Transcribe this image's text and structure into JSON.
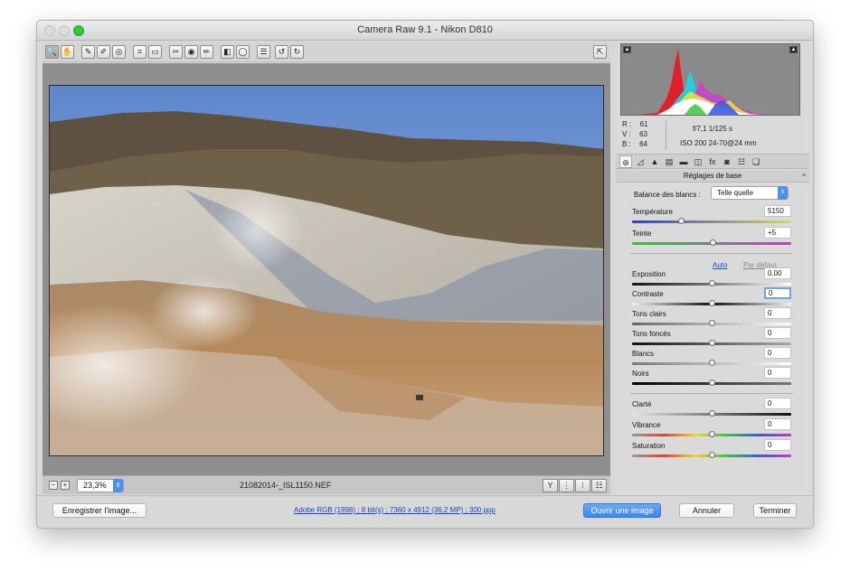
{
  "window": {
    "title": "Camera Raw 9.1  -  Nikon D810"
  },
  "toolbar": {
    "tools": [
      {
        "name": "zoom-tool",
        "glyph": "🔍",
        "active": true
      },
      {
        "name": "hand-tool",
        "glyph": "✋"
      },
      {
        "name": "white-balance-tool",
        "glyph": "✎"
      },
      {
        "name": "color-sampler-tool",
        "glyph": "✐"
      },
      {
        "name": "targeted-adjustment-tool",
        "glyph": "◎"
      },
      {
        "name": "crop-tool",
        "glyph": "⌗"
      },
      {
        "name": "straighten-tool",
        "glyph": "▭"
      },
      {
        "name": "spot-removal-tool",
        "glyph": "✂"
      },
      {
        "name": "red-eye-tool",
        "glyph": "◉"
      },
      {
        "name": "adjustment-brush-tool",
        "glyph": "✏"
      },
      {
        "name": "graduated-filter-tool",
        "glyph": "◧"
      },
      {
        "name": "radial-filter-tool",
        "glyph": "◯"
      },
      {
        "name": "preferences-tool",
        "glyph": "☰"
      },
      {
        "name": "rotate-left-tool",
        "glyph": "↺"
      },
      {
        "name": "rotate-right-tool",
        "glyph": "↻"
      }
    ],
    "fullscreen_glyph": "⇱"
  },
  "status": {
    "zoom": "23,3%",
    "filename": "21082014-_ISL1150.NEF",
    "view_buttons": [
      "Y",
      "⋮",
      "⁝",
      "☷"
    ]
  },
  "readout": {
    "r_label": "R :",
    "r_value": "61",
    "v_label": "V :",
    "v_value": "63",
    "b_label": "B :",
    "b_value": "64",
    "aperture_shutter": "f/7,1   1/125 s",
    "iso_lens": "ISO 200   24-70@24 mm"
  },
  "panel_tabs": [
    "⊛",
    "◿",
    "▲",
    "▤",
    "▬",
    "◫",
    "fx",
    "◙",
    "☷",
    "❑"
  ],
  "panel": {
    "title": "Réglages de base",
    "menu_glyph": "≡",
    "wb_label": "Balance des blancs :",
    "wb_value": "Telle quelle",
    "auto_label": "Auto",
    "default_label": "Par défaut"
  },
  "sliders": [
    {
      "key": "temperature",
      "label": "Température",
      "value": "5150",
      "level": 0.31,
      "track": "linear-gradient(90deg,#2f3fc8,#d9d75a)"
    },
    {
      "key": "tint",
      "label": "Teinte",
      "value": "+5",
      "level": 0.51,
      "track": "linear-gradient(90deg,#35c43a,#c13ec8)"
    },
    {
      "key": "exposure",
      "label": "Exposition",
      "value": "0,00",
      "level": 0.5,
      "track": "linear-gradient(90deg,#111,#777,#fff)"
    },
    {
      "key": "contrast",
      "label": "Contraste",
      "value": "0",
      "level": 0.5,
      "track": "linear-gradient(90deg,#f2f2f2,#111,#f2f2f2)",
      "focus": true
    },
    {
      "key": "highlights",
      "label": "Tons clairs",
      "value": "0",
      "level": 0.5,
      "track": "linear-gradient(90deg,#666,#fff)"
    },
    {
      "key": "shadows",
      "label": "Tons foncés",
      "value": "0",
      "level": 0.5,
      "track": "linear-gradient(90deg,#111,#aaa)"
    },
    {
      "key": "whites",
      "label": "Blancs",
      "value": "0",
      "level": 0.5,
      "track": "linear-gradient(90deg,#777,#fff)"
    },
    {
      "key": "blacks",
      "label": "Noirs",
      "value": "0",
      "level": 0.5,
      "track": "linear-gradient(90deg,#000,#777)"
    },
    {
      "key": "clarity",
      "label": "Clarté",
      "value": "0",
      "level": 0.5,
      "track": "linear-gradient(90deg,#e5e5e5,#111)"
    },
    {
      "key": "vibrance",
      "label": "Vibrance",
      "value": "0",
      "level": 0.5,
      "track": "linear-gradient(90deg,#9a9a9a,#e1422c,#f0d23a,#3fbf3f,#3a5ad8,#c23ac8)"
    },
    {
      "key": "saturation",
      "label": "Saturation",
      "value": "0",
      "level": 0.5,
      "track": "linear-gradient(90deg,#9a9a9a,#e1422c,#f0d23a,#3fbf3f,#3a5ad8,#c23ac8)"
    }
  ],
  "bottom": {
    "save_label": "Enregistrer l'image...",
    "info_link": "Adobe RGB (1998) ; 8 bit(s) ; 7360 x 4912 (36,2 MP) ; 300 ppp",
    "open_label": "Ouvrir une image",
    "cancel_label": "Annuler",
    "done_label": "Terminer"
  },
  "colors": {
    "accent": "#3a86f1",
    "link": "#1f40c8",
    "panel_bg": "#dadada",
    "preview_bg": "#8f8f8f"
  }
}
